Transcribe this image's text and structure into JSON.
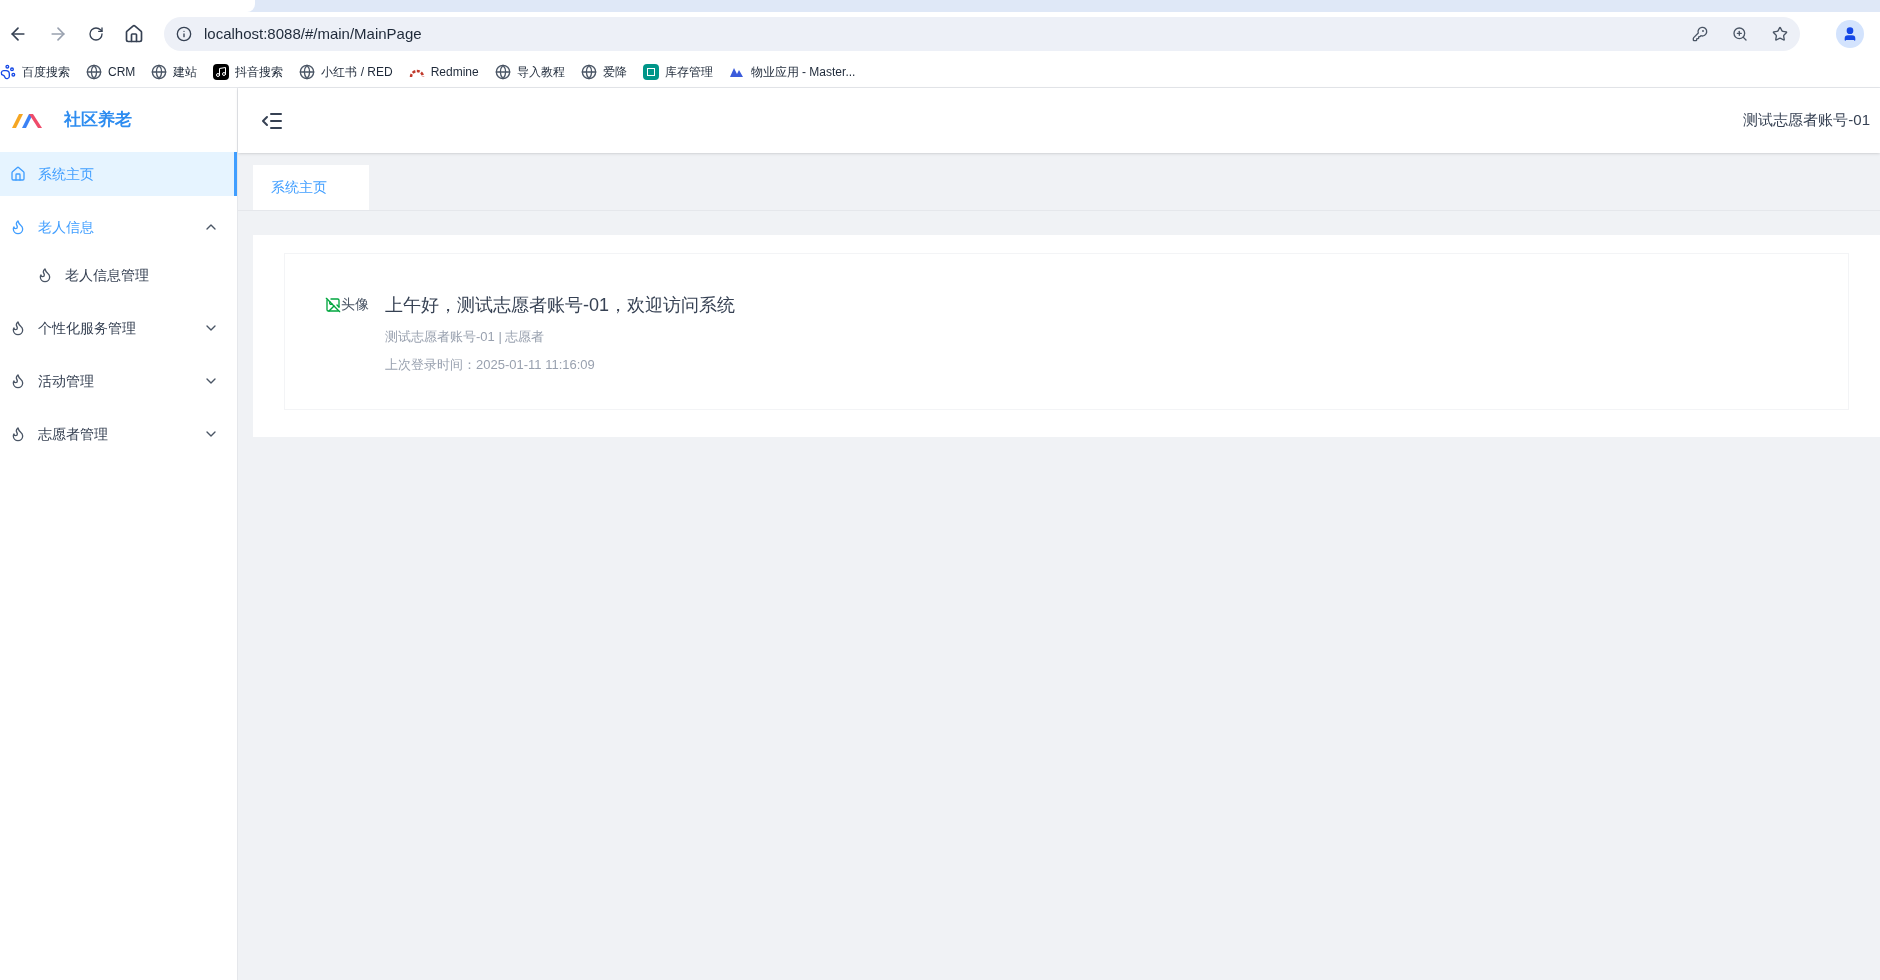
{
  "browser": {
    "url": "localhost:8088/#/main/MainPage",
    "bookmarks": [
      {
        "label": "百度搜索",
        "kind": "paw"
      },
      {
        "label": "CRM",
        "kind": "globe"
      },
      {
        "label": "建站",
        "kind": "globe"
      },
      {
        "label": "抖音搜索",
        "kind": "note"
      },
      {
        "label": "小红书 / RED",
        "kind": "globe"
      },
      {
        "label": "Redmine",
        "kind": "arc"
      },
      {
        "label": "导入教程",
        "kind": "globe"
      },
      {
        "label": "爱降",
        "kind": "globe"
      },
      {
        "label": "库存管理",
        "kind": "sheet"
      },
      {
        "label": "物业应用 - Master...",
        "kind": "peaks"
      }
    ]
  },
  "app": {
    "logo_text": "社区养老",
    "user_name": "测试志愿者账号-01",
    "menu": [
      {
        "label": "系统主页",
        "kind": "home",
        "selected": true
      },
      {
        "label": "老人信息",
        "kind": "group",
        "selected": false,
        "expanded": true,
        "children": [
          {
            "label": "老人信息管理",
            "selected": false
          }
        ]
      },
      {
        "label": "个性化服务管理",
        "kind": "group",
        "selected": false,
        "expanded": false
      },
      {
        "label": "活动管理",
        "kind": "group",
        "selected": false,
        "expanded": false
      },
      {
        "label": "志愿者管理",
        "kind": "group",
        "selected": false,
        "expanded": false
      }
    ],
    "tabs": [
      {
        "label": "系统主页",
        "selected": true
      }
    ],
    "welcome": {
      "avatar_alt": "头像",
      "greeting": "上午好，测试志愿者账号-01，欢迎访问系统",
      "subtitle": "测试志愿者账号-01 | 志愿者",
      "last_login": "上次登录时间：2025-01-11 11:16:09"
    }
  }
}
